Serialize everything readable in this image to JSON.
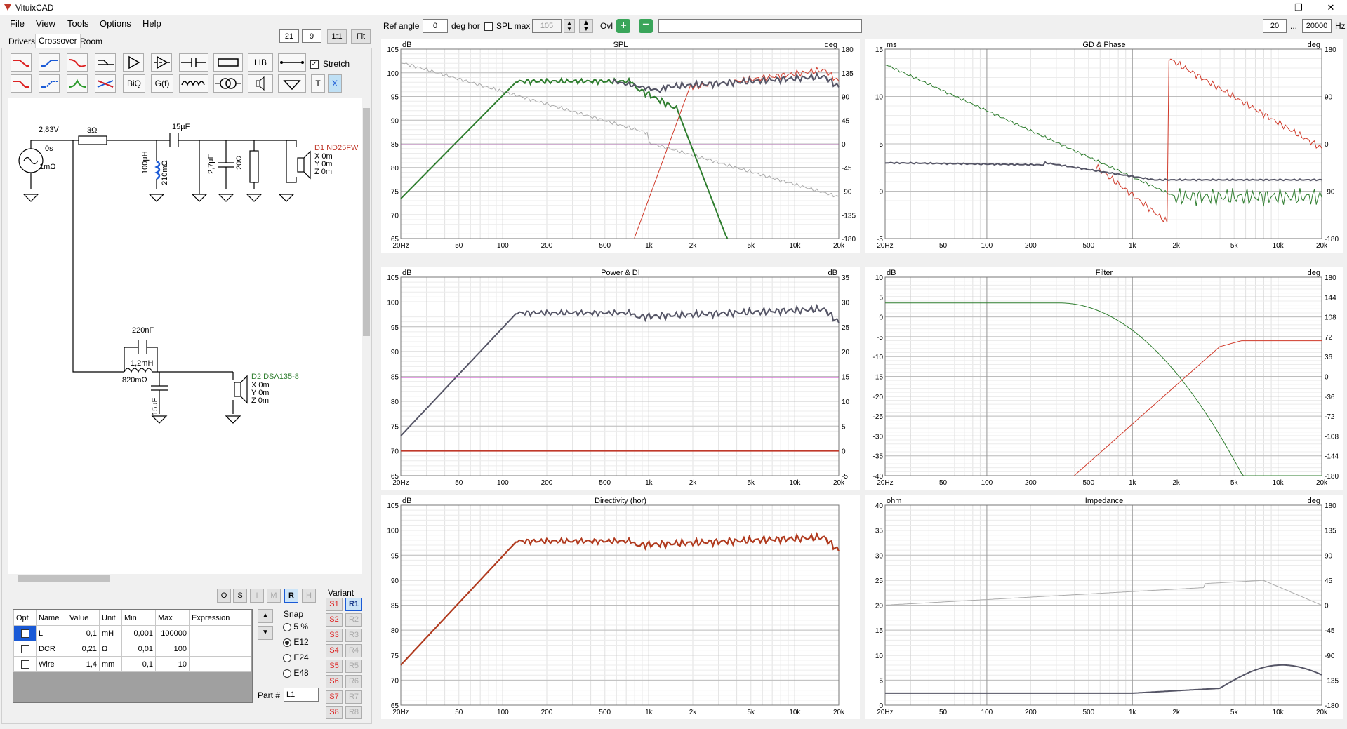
{
  "window": {
    "title": "VituixCAD"
  },
  "menu": [
    "File",
    "View",
    "Tools",
    "Options",
    "Help"
  ],
  "zoom": {
    "a": "21",
    "b": "9",
    "one": "1:1",
    "fit": "Fit"
  },
  "tabs": [
    "Drivers",
    "Crossover",
    "Room"
  ],
  "toolbar": {
    "lib": "LIB",
    "stretch": "Stretch",
    "biq": "BiQ",
    "gf": "G(f)",
    "t": "T",
    "x": "X"
  },
  "header": {
    "ref_angle_label": "Ref angle",
    "ref_angle_value": "0",
    "deg_hor": "deg hor",
    "spl_max_label": "SPL max",
    "spl_max_value": "105",
    "ovl": "Ovl",
    "freq_min": "20",
    "freq_sep": "...",
    "freq_max": "20000",
    "hz": "Hz"
  },
  "schematic": {
    "source": {
      "voltage": "2,83V",
      "delay": "0s",
      "res": "1mΩ"
    },
    "r1": "3Ω",
    "c1": "15µF",
    "l1a": "100µH",
    "l1b": "210mΩ",
    "c2": "2,7µF",
    "r2": "20Ω",
    "d1": {
      "name": "D1 ND25FW",
      "x": "X 0m",
      "y": "Y 0m",
      "z": "Z 0m"
    },
    "c3": "220nF",
    "l2a": "1,2mH",
    "l2b": "820mΩ",
    "c4": "15µF",
    "d2": {
      "name": "D2 DSA135-8",
      "x": "X 0m",
      "y": "Y 0m",
      "z": "Z 0m"
    }
  },
  "modebuttons": [
    "O",
    "S",
    "I",
    "M",
    "R",
    "H"
  ],
  "table": {
    "headers": [
      "Opt",
      "Name",
      "Value",
      "Unit",
      "Min",
      "Max",
      "Expression"
    ],
    "rows": [
      {
        "name": "L",
        "value": "0,1",
        "unit": "mH",
        "min": "0,001",
        "max": "100000"
      },
      {
        "name": "DCR",
        "value": "0,21",
        "unit": "Ω",
        "min": "0,01",
        "max": "100"
      },
      {
        "name": "Wire",
        "value": "1,4",
        "unit": "mm",
        "min": "0,1",
        "max": "10"
      }
    ]
  },
  "snap": {
    "label": "Snap",
    "options": [
      "5 %",
      "E12",
      "E24",
      "E48"
    ],
    "selected": "E12"
  },
  "part": {
    "label": "Part #",
    "value": "L1"
  },
  "variant": {
    "label": "Variant",
    "s": [
      "S1",
      "S2",
      "S3",
      "S4",
      "S5",
      "S6",
      "S7",
      "S8"
    ],
    "r": [
      "R1",
      "R2",
      "R3",
      "R4",
      "R5",
      "R6",
      "R7",
      "R8"
    ]
  },
  "xticks": [
    "20Hz",
    "50",
    "100",
    "200",
    "500",
    "1k",
    "2k",
    "5k",
    "10k",
    "20k"
  ],
  "panels": {
    "spl": {
      "title": "SPL",
      "lunit": "dB",
      "runit": "deg",
      "left": [
        "105",
        "100",
        "95",
        "90",
        "85",
        "80",
        "75",
        "70",
        "65"
      ],
      "right": [
        "180",
        "135",
        "90",
        "45",
        "0",
        "-45",
        "-90",
        "-135",
        "-180"
      ]
    },
    "gd": {
      "title": "GD & Phase",
      "lunit": "ms",
      "runit": "deg",
      "left": [
        "15",
        "10",
        "5",
        "0",
        "-5"
      ],
      "right": [
        "180",
        "90",
        "0",
        "-90",
        "-180"
      ]
    },
    "power": {
      "title": "Power & DI",
      "lunit": "dB",
      "runit": "dB",
      "left": [
        "105",
        "100",
        "95",
        "90",
        "85",
        "80",
        "75",
        "70",
        "65"
      ],
      "right": [
        "35",
        "30",
        "25",
        "20",
        "15",
        "10",
        "5",
        "0",
        "-5"
      ]
    },
    "filter": {
      "title": "Filter",
      "lunit": "dB",
      "runit": "deg",
      "left": [
        "10",
        "5",
        "0",
        "-5",
        "-10",
        "-15",
        "-20",
        "-25",
        "-30",
        "-35",
        "-40"
      ],
      "right": [
        "180",
        "144",
        "108",
        "72",
        "36",
        "0",
        "-36",
        "-72",
        "-108",
        "-144",
        "-180"
      ]
    },
    "dir": {
      "title": "Directivity (hor)",
      "lunit": "dB",
      "runit": "",
      "left": [
        "105",
        "100",
        "95",
        "90",
        "85",
        "80",
        "75",
        "70",
        "65"
      ],
      "right": []
    },
    "imp": {
      "title": "Impedance",
      "lunit": "ohm",
      "runit": "deg",
      "left": [
        "40",
        "35",
        "30",
        "25",
        "20",
        "15",
        "10",
        "5",
        "0"
      ],
      "right": [
        "180",
        "135",
        "90",
        "45",
        "0",
        "-45",
        "-90",
        "-135",
        "-180"
      ]
    }
  },
  "colors": {
    "woofer": "#2e7d2e",
    "tweeter": "#c0392b",
    "sum": "#555566",
    "ref": "#cc44cc",
    "dir": "#b03a1e"
  }
}
